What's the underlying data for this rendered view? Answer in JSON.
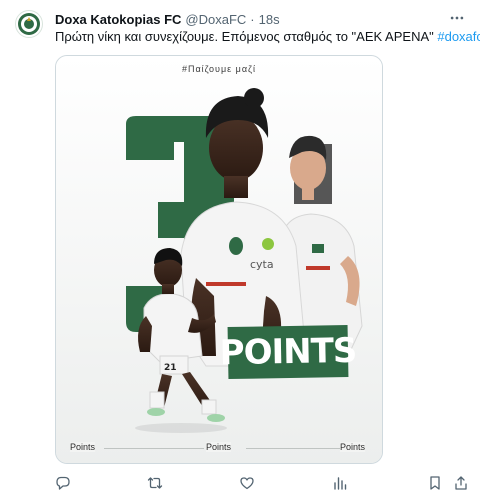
{
  "account": {
    "name": "Doxa Katokopias FC",
    "handle": "@DoxaFC",
    "separator": "·",
    "time": "18s"
  },
  "tweet": {
    "text": "Πρώτη νίκη και συνεχίζουμε. Επόμενος σταθμός το \"ΑΕΚ ΑΡΕΝΑ\" ",
    "hashtag": "#doxafc"
  },
  "media": {
    "hashtag": "#Παίζουμε μαζί",
    "big_number": "3",
    "points_label": "POINTS",
    "bottom_labels": [
      "Points",
      "Points",
      "Points"
    ],
    "colors": {
      "green": "#2f6a45",
      "background": "#f3f4f3",
      "kit": "#f2f2f2"
    }
  },
  "actions": {
    "icons": [
      "reply-icon",
      "retweet-icon",
      "like-icon",
      "views-icon",
      "bookmark-icon",
      "share-icon"
    ]
  }
}
